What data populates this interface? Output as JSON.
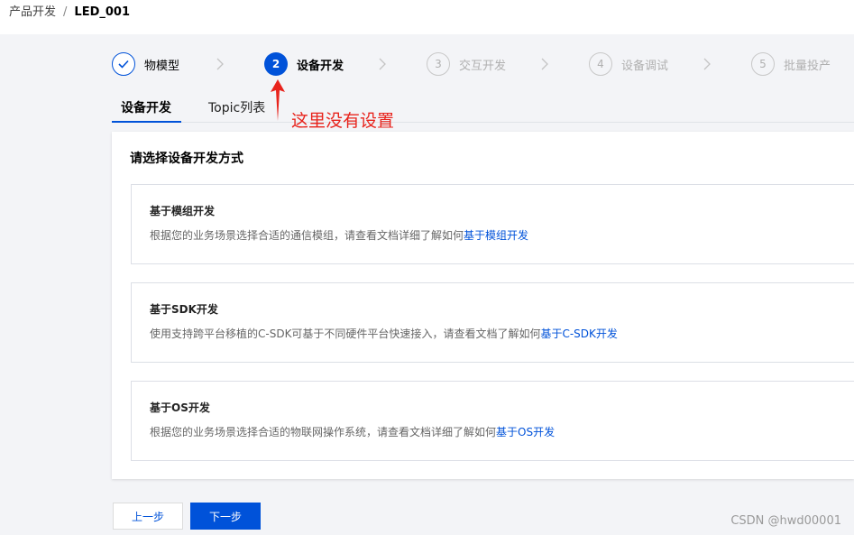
{
  "breadcrumb": {
    "parent": "产品开发",
    "separator": "/",
    "current": "LED_001"
  },
  "steps": [
    {
      "number": "",
      "label": "物模型",
      "state": "done",
      "icon": "check-icon"
    },
    {
      "number": "2",
      "label": "设备开发",
      "state": "active"
    },
    {
      "number": "3",
      "label": "交互开发",
      "state": "todo"
    },
    {
      "number": "4",
      "label": "设备调试",
      "state": "todo"
    },
    {
      "number": "5",
      "label": "批量投产",
      "state": "todo"
    }
  ],
  "tabs": [
    {
      "label": "设备开发",
      "active": true
    },
    {
      "label": "Topic列表",
      "active": false
    }
  ],
  "annotation": {
    "text": "这里没有设置",
    "color": "#e8231c"
  },
  "panel": {
    "title": "请选择设备开发方式",
    "options": [
      {
        "title": "基于模组开发",
        "desc": "根据您的业务场景选择合适的通信模组，请查看文档详细了解如何",
        "link": "基于模组开发"
      },
      {
        "title": "基于SDK开发",
        "desc": "使用支持跨平台移植的C-SDK可基于不同硬件平台快速接入，请查看文档了解如何",
        "link": "基于C-SDK开发"
      },
      {
        "title": "基于OS开发",
        "desc": "根据您的业务场景选择合适的物联网操作系统，请查看文档详细了解如何",
        "link": "基于OS开发"
      }
    ]
  },
  "buttons": {
    "prev": "上一步",
    "next": "下一步"
  },
  "watermark": "CSDN @hwd00001",
  "colors": {
    "primary": "#0052d9",
    "annotation": "#e8231c",
    "background": "#f3f4f7"
  }
}
